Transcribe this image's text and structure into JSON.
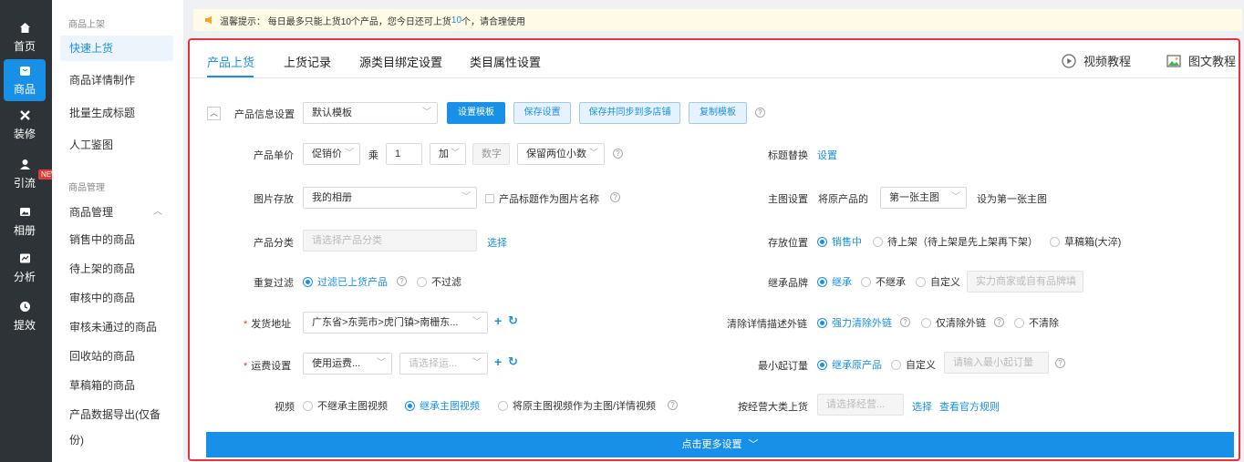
{
  "nav": {
    "items": [
      {
        "label": "首页",
        "icon": "home-icon"
      },
      {
        "label": "商品",
        "icon": "goods-icon"
      },
      {
        "label": "装修",
        "icon": "decorate-icon"
      },
      {
        "label": "引流",
        "icon": "traffic-icon",
        "badge": "NEW"
      },
      {
        "label": "相册",
        "icon": "album-icon"
      },
      {
        "label": "分析",
        "icon": "analysis-icon"
      },
      {
        "label": "提效",
        "icon": "efficiency-icon"
      }
    ],
    "active_color": "#1890e8"
  },
  "submenu": {
    "group1": "商品上架",
    "quick_upload": "快速上货",
    "detail_make": "商品详情制作",
    "batch_title": "批量生成标题",
    "manual_check": "人工鉴图",
    "group2": "商品管理",
    "manage": "商品管理",
    "on_sale": "销售中的商品",
    "pending": "待上架的商品",
    "reviewing": "审核中的商品",
    "rejected": "审核未通过的商品",
    "recycle": "回收站的商品",
    "drafts": "草稿箱的商品",
    "export": "产品数据导出(仅备份)"
  },
  "notice": {
    "prefix": "温馨提示：  每日最多只能上货10个产品，您今日还可上货",
    "count": "10",
    "suffix": "个，请合理使用"
  },
  "tabs": [
    "产品上货",
    "上货记录",
    "源类目绑定设置",
    "类目属性设置"
  ],
  "tutorials": {
    "video": "视频教程",
    "graphic": "图文教程"
  },
  "form": {
    "info_setting": {
      "label": "产品信息设置",
      "template": "默认模板",
      "btn_set": "设置模板",
      "btn_save": "保存设置",
      "btn_save_sync": "保存并同步到多店铺",
      "btn_copy": "复制模板"
    },
    "unit_price": {
      "label": "产品单价",
      "source": "促销价",
      "multiply": "乘",
      "factor": "1",
      "op": "加",
      "number_ph": "数字",
      "rounding": "保留两位小数"
    },
    "title_replace": {
      "label": "标题替换",
      "link": "设置"
    },
    "image_store": {
      "label": "图片存放",
      "value": "我的相册",
      "checkbox": "产品标题作为图片名称"
    },
    "main_image": {
      "label": "主图设置",
      "prefix": "将原产品的",
      "value": "第一张主图",
      "suffix": "设为第一张主图"
    },
    "category": {
      "label": "产品分类",
      "placeholder": "请选择产品分类",
      "link": "选择"
    },
    "storage": {
      "label": "存放位置",
      "opt1": "销售中",
      "opt2": "待上架（待上架是先上架再下架）",
      "opt3": "草稿箱(大淬)"
    },
    "dup_filter": {
      "label": "重复过滤",
      "opt1": "过滤已上货产品",
      "opt2": "不过滤"
    },
    "brand": {
      "label": "继承品牌",
      "opt1": "继承",
      "opt2": "不继承",
      "opt3": "自定义",
      "placeholder": "实力商家或自有品牌填"
    },
    "ship_addr": {
      "label": "发货地址",
      "value": "广东省>东莞市>虎门镇>南栅东..."
    },
    "clear_links": {
      "label": "清除详情描述外链",
      "opt1": "强力清除外链",
      "opt2": "仅清除外链",
      "opt3": "不清除"
    },
    "freight": {
      "label": "运费设置",
      "value": "使用运费...",
      "placeholder": "请选择运..."
    },
    "min_order": {
      "label": "最小起订量",
      "opt1": "继承原产品",
      "opt2": "自定义",
      "placeholder": "请输入最小起订量"
    },
    "video": {
      "label": "视频",
      "opt1": "不继承主图视频",
      "opt2": "继承主图视频",
      "opt3": "将原主图视频作为主图/详情视频"
    },
    "biz_category": {
      "label": "按经营大类上货",
      "placeholder": "请选择经营...",
      "link1": "选择",
      "link2": "查看官方规则"
    }
  },
  "more_settings": "点击更多设置"
}
